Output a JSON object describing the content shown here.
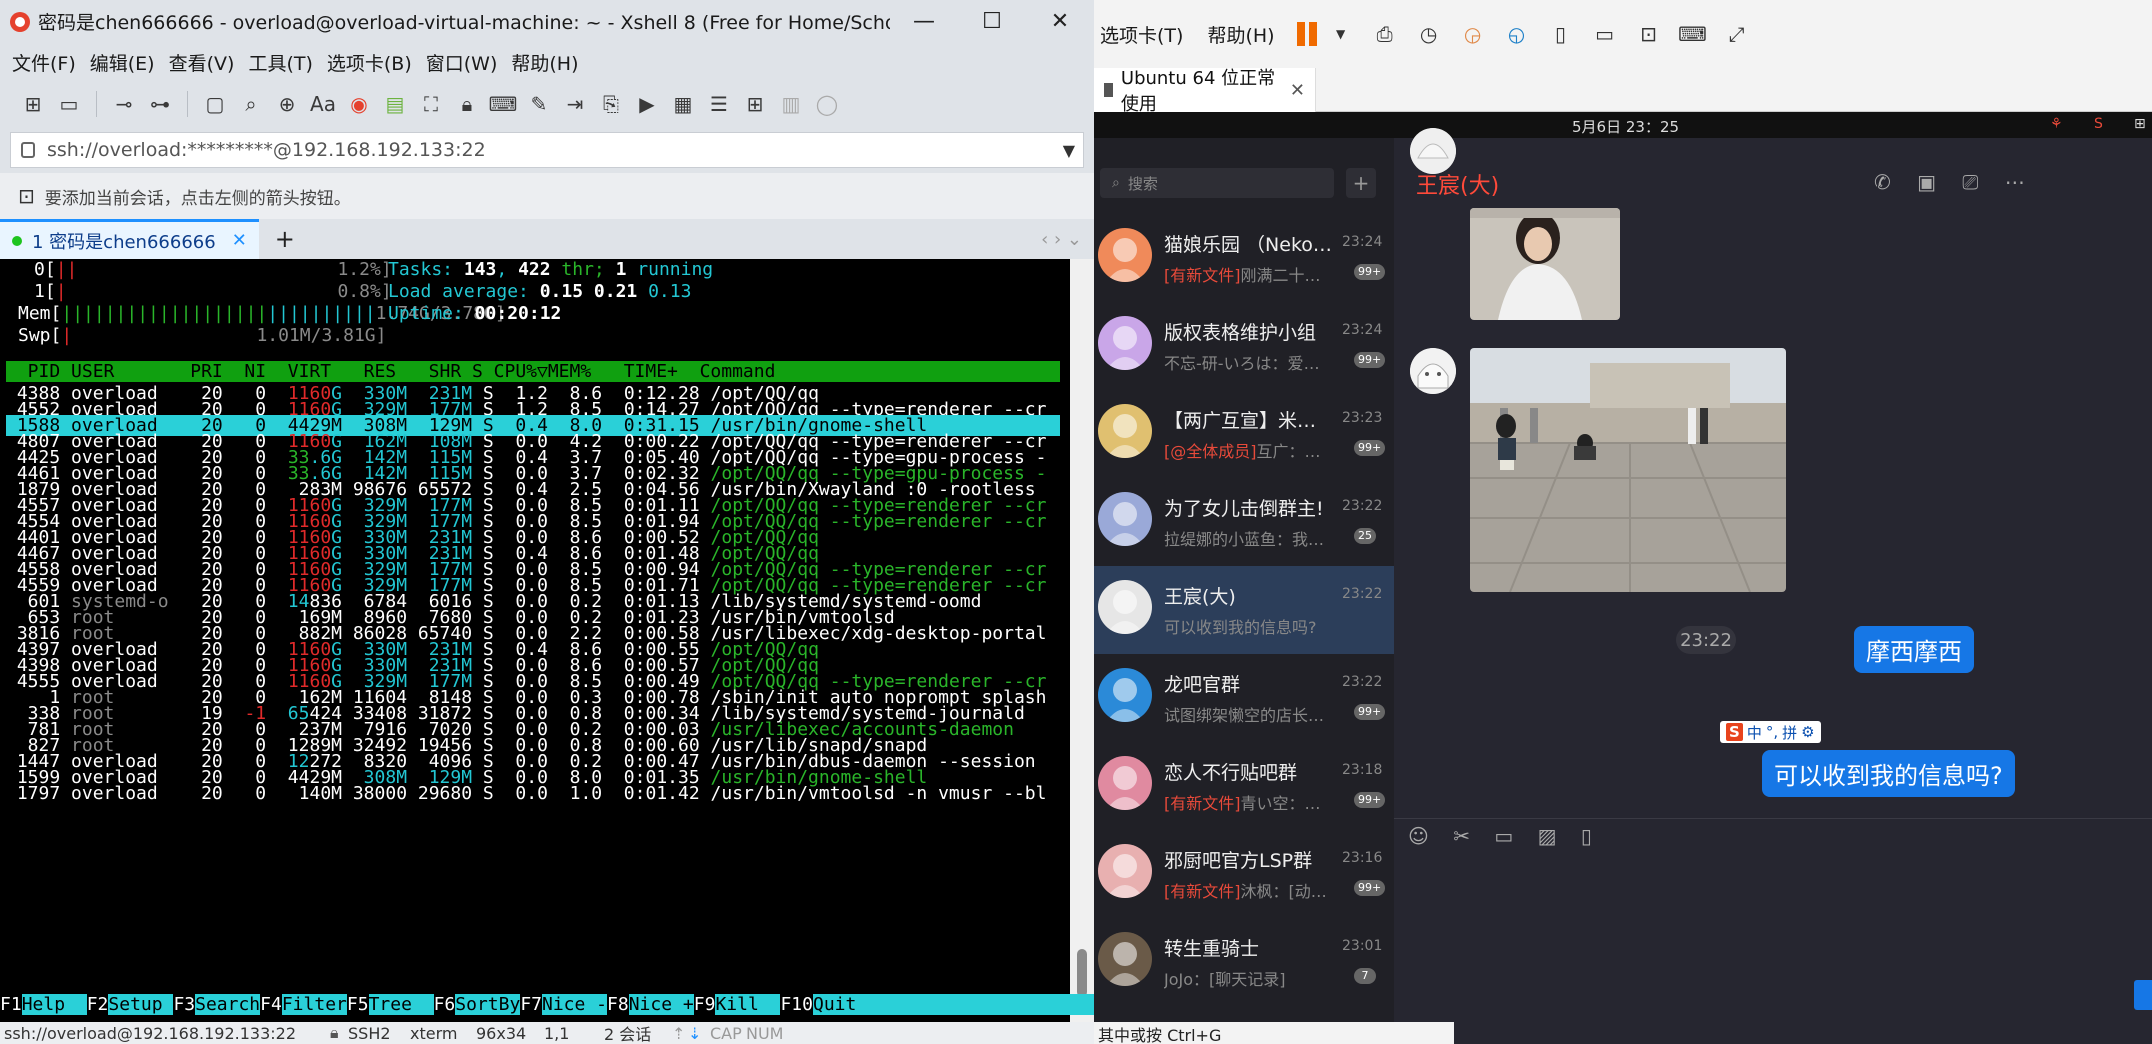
{
  "xshell": {
    "title": "密码是chen666666 - overload@overload-virtual-machine: ~ - Xshell 8 (Free for Home/School)",
    "win_minimize": "—",
    "win_maximize": "☐",
    "win_close": "✕",
    "menu": [
      "文件(F)",
      "编辑(E)",
      "查看(V)",
      "工具(T)",
      "选项卡(B)",
      "窗口(W)",
      "帮助(H)"
    ],
    "address": "ssh://overload:*********@192.168.192.133:22",
    "hint": "要添加当前会话，点击左侧的箭头按钮。",
    "tab_label": "1 密码是chen666666",
    "tab_close": "✕",
    "new_tab": "+",
    "tab_nav": "‹ ›  ⌄"
  },
  "htop": {
    "cpu0": {
      "label": "0[",
      "bar": "||",
      "pct": "1.2%]"
    },
    "cpu1": {
      "label": "1[",
      "bar": "|",
      "pct": "0.8%]"
    },
    "mem": {
      "label": "Mem[",
      "bar": "|||||||||||||||||||||||||||||",
      "val": "1.74G/3.78G]"
    },
    "swp": {
      "label": "Swp[",
      "bar": "|",
      "val": "1.01M/3.81G]"
    },
    "tasks_label": "Tasks: ",
    "tasks": "143",
    "tasks_sep": ", ",
    "threads": "422",
    "thr_label": " thr; ",
    "running": "1",
    "running_label": " running",
    "load_label": "Load average: ",
    "load1": "0.15",
    "load5": "0.21",
    "load15": "0.13",
    "uptime_label": "Uptime: ",
    "uptime": "00:20:12",
    "header": "  PID USER       PRI  NI  VIRT   RES   SHR S CPU%▽MEM%   TIME+  Command",
    "rows": [
      {
        "pid": "4388",
        "user": "overload",
        "pri": "20",
        "ni": "0",
        "virt": "1160G",
        "res": "330M",
        "shr": "231M",
        "s": "S",
        "cpu": "1.2",
        "mem": "8.6",
        "time": "0:12.28",
        "cmd": "/opt/QQ/qq",
        "cmdc": "w"
      },
      {
        "pid": "4552",
        "user": "overload",
        "pri": "20",
        "ni": "0",
        "virt": "1160G",
        "res": "329M",
        "shr": "177M",
        "s": "S",
        "cpu": "1.2",
        "mem": "8.5",
        "time": "0:14.27",
        "cmd": "/opt/QQ/qq --type=renderer --cr",
        "cmdc": "w"
      },
      {
        "pid": "1588",
        "user": "overload",
        "pri": "20",
        "ni": "0",
        "virt": "4429M",
        "res": "308M",
        "shr": "129M",
        "s": "S",
        "cpu": "0.4",
        "mem": "8.0",
        "time": "0:31.15",
        "cmd": "/usr/bin/gnome-shell",
        "cmdc": "w",
        "sel": true
      },
      {
        "pid": "4807",
        "user": "overload",
        "pri": "20",
        "ni": "0",
        "virt": "1160G",
        "res": "162M",
        "shr": "108M",
        "s": "S",
        "cpu": "0.0",
        "mem": "4.2",
        "time": "0:00.22",
        "cmd": "/opt/QQ/qq --type=renderer --cr",
        "cmdc": "w"
      },
      {
        "pid": "4425",
        "user": "overload",
        "pri": "20",
        "ni": "0",
        "virt": "33.6G",
        "res": "142M",
        "shr": "115M",
        "s": "S",
        "cpu": "0.4",
        "mem": "3.7",
        "time": "0:05.40",
        "cmd": "/opt/QQ/qq --type=gpu-process -",
        "cmdc": "w"
      },
      {
        "pid": "4461",
        "user": "overload",
        "pri": "20",
        "ni": "0",
        "virt": "33.6G",
        "res": "142M",
        "shr": "115M",
        "s": "S",
        "cpu": "0.0",
        "mem": "3.7",
        "time": "0:02.32",
        "cmd": "/opt/QQ/qq --type=gpu-process -",
        "cmdc": "g"
      },
      {
        "pid": "1879",
        "user": "overload",
        "pri": "20",
        "ni": "0",
        "virt": "283M",
        "res": "98676",
        "shr": "65572",
        "s": "S",
        "cpu": "0.4",
        "mem": "2.5",
        "time": "0:04.56",
        "cmd": "/usr/bin/Xwayland :0 -rootless",
        "cmdc": "w"
      },
      {
        "pid": "4557",
        "user": "overload",
        "pri": "20",
        "ni": "0",
        "virt": "1160G",
        "res": "329M",
        "shr": "177M",
        "s": "S",
        "cpu": "0.0",
        "mem": "8.5",
        "time": "0:01.11",
        "cmd": "/opt/QQ/qq --type=renderer --cr",
        "cmdc": "g"
      },
      {
        "pid": "4554",
        "user": "overload",
        "pri": "20",
        "ni": "0",
        "virt": "1160G",
        "res": "329M",
        "shr": "177M",
        "s": "S",
        "cpu": "0.0",
        "mem": "8.5",
        "time": "0:01.94",
        "cmd": "/opt/QQ/qq --type=renderer --cr",
        "cmdc": "g"
      },
      {
        "pid": "4401",
        "user": "overload",
        "pri": "20",
        "ni": "0",
        "virt": "1160G",
        "res": "330M",
        "shr": "231M",
        "s": "S",
        "cpu": "0.0",
        "mem": "8.6",
        "time": "0:00.52",
        "cmd": "/opt/QQ/qq",
        "cmdc": "g"
      },
      {
        "pid": "4467",
        "user": "overload",
        "pri": "20",
        "ni": "0",
        "virt": "1160G",
        "res": "330M",
        "shr": "231M",
        "s": "S",
        "cpu": "0.4",
        "mem": "8.6",
        "time": "0:01.48",
        "cmd": "/opt/QQ/qq",
        "cmdc": "g"
      },
      {
        "pid": "4558",
        "user": "overload",
        "pri": "20",
        "ni": "0",
        "virt": "1160G",
        "res": "329M",
        "shr": "177M",
        "s": "S",
        "cpu": "0.0",
        "mem": "8.5",
        "time": "0:00.94",
        "cmd": "/opt/QQ/qq --type=renderer --cr",
        "cmdc": "g"
      },
      {
        "pid": "4559",
        "user": "overload",
        "pri": "20",
        "ni": "0",
        "virt": "1160G",
        "res": "329M",
        "shr": "177M",
        "s": "S",
        "cpu": "0.0",
        "mem": "8.5",
        "time": "0:01.71",
        "cmd": "/opt/QQ/qq --type=renderer --cr",
        "cmdc": "g"
      },
      {
        "pid": "601",
        "user": "systemd-o",
        "pri": "20",
        "ni": "0",
        "virt": "14836",
        "res": "6784",
        "shr": "6016",
        "s": "S",
        "cpu": "0.0",
        "mem": "0.2",
        "time": "0:01.13",
        "cmd": "/lib/systemd/systemd-oomd",
        "cmdc": "w",
        "ugray": true
      },
      {
        "pid": "653",
        "user": "root",
        "pri": "20",
        "ni": "0",
        "virt": "169M",
        "res": "8960",
        "shr": "7680",
        "s": "S",
        "cpu": "0.0",
        "mem": "0.2",
        "time": "0:01.23",
        "cmd": "/usr/bin/vmtoolsd",
        "cmdc": "w",
        "ugray": true
      },
      {
        "pid": "3816",
        "user": "root",
        "pri": "20",
        "ni": "0",
        "virt": "882M",
        "res": "86028",
        "shr": "65740",
        "s": "S",
        "cpu": "0.0",
        "mem": "2.2",
        "time": "0:00.58",
        "cmd": "/usr/libexec/xdg-desktop-portal",
        "cmdc": "w",
        "ugray": true
      },
      {
        "pid": "4397",
        "user": "overload",
        "pri": "20",
        "ni": "0",
        "virt": "1160G",
        "res": "330M",
        "shr": "231M",
        "s": "S",
        "cpu": "0.4",
        "mem": "8.6",
        "time": "0:00.55",
        "cmd": "/opt/QQ/qq",
        "cmdc": "g"
      },
      {
        "pid": "4398",
        "user": "overload",
        "pri": "20",
        "ni": "0",
        "virt": "1160G",
        "res": "330M",
        "shr": "231M",
        "s": "S",
        "cpu": "0.0",
        "mem": "8.6",
        "time": "0:00.57",
        "cmd": "/opt/QQ/qq",
        "cmdc": "g"
      },
      {
        "pid": "4555",
        "user": "overload",
        "pri": "20",
        "ni": "0",
        "virt": "1160G",
        "res": "329M",
        "shr": "177M",
        "s": "S",
        "cpu": "0.0",
        "mem": "8.5",
        "time": "0:00.49",
        "cmd": "/opt/QQ/qq --type=renderer --cr",
        "cmdc": "g"
      },
      {
        "pid": "1",
        "user": "root",
        "pri": "20",
        "ni": "0",
        "virt": "162M",
        "res": "11604",
        "shr": "8148",
        "s": "S",
        "cpu": "0.0",
        "mem": "0.3",
        "time": "0:00.78",
        "cmd": "/sbin/init auto noprompt splash",
        "cmdc": "w",
        "ugray": true
      },
      {
        "pid": "338",
        "user": "root",
        "pri": "19",
        "ni": "-1",
        "virt": "65424",
        "res": "33408",
        "shr": "31872",
        "s": "S",
        "cpu": "0.0",
        "mem": "0.8",
        "time": "0:00.34",
        "cmd": "/lib/systemd/systemd-journald",
        "cmdc": "w",
        "ugray": true
      },
      {
        "pid": "781",
        "user": "root",
        "pri": "20",
        "ni": "0",
        "virt": "237M",
        "res": "7916",
        "shr": "7020",
        "s": "S",
        "cpu": "0.0",
        "mem": "0.2",
        "time": "0:00.03",
        "cmd": "/usr/libexec/accounts-daemon",
        "cmdc": "g",
        "ugray": true
      },
      {
        "pid": "827",
        "user": "root",
        "pri": "20",
        "ni": "0",
        "virt": "1289M",
        "res": "32492",
        "shr": "19456",
        "s": "S",
        "cpu": "0.0",
        "mem": "0.8",
        "time": "0:00.60",
        "cmd": "/usr/lib/snapd/snapd",
        "cmdc": "w",
        "ugray": true
      },
      {
        "pid": "1447",
        "user": "overload",
        "pri": "20",
        "ni": "0",
        "virt": "12272",
        "res": "8320",
        "shr": "4096",
        "s": "S",
        "cpu": "0.0",
        "mem": "0.2",
        "time": "0:00.47",
        "cmd": "/usr/bin/dbus-daemon --session",
        "cmdc": "w"
      },
      {
        "pid": "1599",
        "user": "overload",
        "pri": "20",
        "ni": "0",
        "virt": "4429M",
        "res": "308M",
        "shr": "129M",
        "s": "S",
        "cpu": "0.0",
        "mem": "8.0",
        "time": "0:01.35",
        "cmd": "/usr/bin/gnome-shell",
        "cmdc": "g"
      },
      {
        "pid": "1797",
        "user": "overload",
        "pri": "20",
        "ni": "0",
        "virt": "140M",
        "res": "38000",
        "shr": "29680",
        "s": "S",
        "cpu": "0.0",
        "mem": "1.0",
        "time": "0:01.42",
        "cmd": "/usr/bin/vmtoolsd -n vmusr --bl",
        "cmdc": "w"
      }
    ],
    "fkeys": [
      {
        "k": "F1",
        "l": "Help  "
      },
      {
        "k": "F2",
        "l": "Setup "
      },
      {
        "k": "F3",
        "l": "Search"
      },
      {
        "k": "F4",
        "l": "Filter"
      },
      {
        "k": "F5",
        "l": "Tree  "
      },
      {
        "k": "F6",
        "l": "SortBy"
      },
      {
        "k": "F7",
        "l": "Nice -"
      },
      {
        "k": "F8",
        "l": "Nice +"
      },
      {
        "k": "F9",
        "l": "Kill  "
      },
      {
        "k": "F10",
        "l": "Quit                              "
      }
    ]
  },
  "xshell_status": {
    "host": "ssh://overload@192.168.192.133:22",
    "proto": "SSH2",
    "term": "xterm",
    "size": "96x34",
    "cursor": "1,1",
    "sessions": "2 会话",
    "caps": "CAP",
    "num": "NUM"
  },
  "vmware": {
    "menu": [
      "选项卡(T)",
      "帮助(H)"
    ],
    "tab_label": "Ubuntu 64 位正常使用",
    "tab_close": "✕",
    "clock": "5月6日  23：25"
  },
  "qq": {
    "search_placeholder": "搜索",
    "plus": "+",
    "chats": [
      {
        "name": "猫娘乐园 （Nekop...",
        "time": "23:24",
        "tag": "[有新文件]",
        "preview": "刚满二十二...",
        "badge": "99+",
        "color": "#f08a5a"
      },
      {
        "name": "版权表格维护小组",
        "time": "23:24",
        "tag": "",
        "preview": "不忘-研-いろは：爱奇艺脑",
        "badge": "99+",
        "color": "#c9a6e8"
      },
      {
        "name": "【两广互宣】米托...",
        "time": "23:23",
        "tag": "[@全体成员]",
        "preview": "互广：好...",
        "badge": "99+",
        "color": "#e0c070"
      },
      {
        "name": "为了女儿击倒群主!",
        "time": "23:22",
        "tag": "",
        "preview": "拉缇娜的小蓝鱼：我的常...",
        "badge": "25",
        "color": "#9aa9d8"
      },
      {
        "name": "王宸(大)",
        "time": "23:22",
        "tag": "",
        "preview": "可以收到我的信息吗?",
        "badge": "",
        "color": "#e6e6e6",
        "active": true
      },
      {
        "name": "龙吧官群",
        "time": "23:22",
        "tag": "",
        "preview": "试图绑架懒空的店长：...",
        "badge": "99+",
        "color": "#2b8ad8"
      },
      {
        "name": "恋人不行贴吧群",
        "time": "23:18",
        "tag": "[有新文件]",
        "preview": "青い空：交...",
        "badge": "99+",
        "color": "#e08aa0"
      },
      {
        "name": "邪厨吧官方LSP群",
        "time": "23:16",
        "tag": "[有新文件]",
        "preview": "沐枫：[动画...",
        "badge": "99+",
        "color": "#e8b0b0"
      },
      {
        "name": "转生重骑士",
        "time": "23:01",
        "tag": "",
        "preview": "JoJo：[聊天记录]",
        "badge": "7",
        "color": "#6a5a48"
      }
    ],
    "chat_title": "王宸(大)",
    "time_divider": "23:22",
    "bubble1": "摩西摩西",
    "bubble2": "可以收到我的信息吗?",
    "ime": [
      "中",
      "°,",
      "拼",
      "⚙"
    ],
    "ime_logo": "S",
    "send_hint": "其中或按 Ctrl+G"
  }
}
